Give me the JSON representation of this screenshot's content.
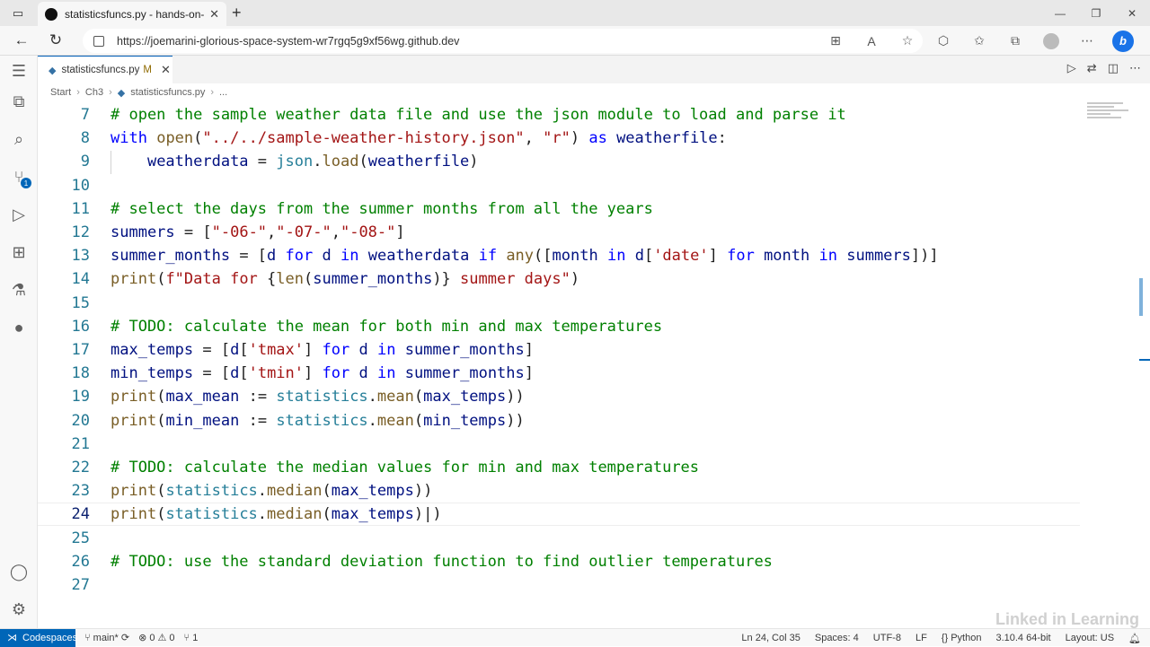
{
  "browser": {
    "tab_title": "statisticsfuncs.py - hands-on-adv",
    "url": "https://joemarini-glorious-space-system-wr7rgq5g9xf56wg.github.dev"
  },
  "editor": {
    "tab_label": "statisticsfuncs.py",
    "tab_modified": "M",
    "breadcrumb": [
      "Start",
      "Ch3",
      "statisticsfuncs.py",
      "..."
    ]
  },
  "code_lines": [
    {
      "n": "7",
      "html": "<span class='com'># open the sample weather data file and use the json module to load and parse it</span>"
    },
    {
      "n": "8",
      "html": "<span class='ctl'>with</span> <span class='fn'>open</span><span class='plain'>(</span><span class='str'>\"../../sample-weather-history.json\"</span><span class='plain'>, </span><span class='str'>\"r\"</span><span class='plain'>) </span><span class='ctl'>as</span> <span class='var'>weatherfile</span><span class='plain'>:</span>"
    },
    {
      "n": "9",
      "html": "    <span class='var'>weatherdata</span> <span class='plain'>=</span> <span class='mod'>json</span><span class='plain'>.</span><span class='fn'>load</span><span class='plain'>(</span><span class='var'>weatherfile</span><span class='plain'>)</span>"
    },
    {
      "n": "10",
      "html": ""
    },
    {
      "n": "11",
      "html": "<span class='com'># select the days from the summer months from all the years</span>"
    },
    {
      "n": "12",
      "html": "<span class='var'>summers</span> <span class='plain'>= [</span><span class='str'>\"-06-\"</span><span class='plain'>,</span><span class='str'>\"-07-\"</span><span class='plain'>,</span><span class='str'>\"-08-\"</span><span class='plain'>]</span>"
    },
    {
      "n": "13",
      "html": "<span class='var'>summer_months</span> <span class='plain'>= [</span><span class='var'>d</span> <span class='ctl'>for</span> <span class='var'>d</span> <span class='ctl'>in</span> <span class='var'>weatherdata</span> <span class='ctl'>if</span> <span class='fn'>any</span><span class='plain'>([</span><span class='var'>month</span> <span class='ctl'>in</span> <span class='var'>d</span><span class='plain'>[</span><span class='str'>'date'</span><span class='plain'>] </span><span class='ctl'>for</span> <span class='var'>month</span> <span class='ctl'>in</span> <span class='var'>summers</span><span class='plain'>])]</span>"
    },
    {
      "n": "14",
      "html": "<span class='fn'>print</span><span class='plain'>(</span><span class='str'>f\"Data for </span><span class='plain'>{</span><span class='fn'>len</span><span class='plain'>(</span><span class='var'>summer_months</span><span class='plain'>)}</span><span class='str'> summer days\"</span><span class='plain'>)</span>"
    },
    {
      "n": "15",
      "html": ""
    },
    {
      "n": "16",
      "html": "<span class='com'># TODO: calculate the mean for both min and max temperatures</span>"
    },
    {
      "n": "17",
      "html": "<span class='var'>max_temps</span> <span class='plain'>= [</span><span class='var'>d</span><span class='plain'>[</span><span class='str'>'tmax'</span><span class='plain'>] </span><span class='ctl'>for</span> <span class='var'>d</span> <span class='ctl'>in</span> <span class='var'>summer_months</span><span class='plain'>]</span>"
    },
    {
      "n": "18",
      "html": "<span class='var'>min_temps</span> <span class='plain'>= [</span><span class='var'>d</span><span class='plain'>[</span><span class='str'>'tmin'</span><span class='plain'>] </span><span class='ctl'>for</span> <span class='var'>d</span> <span class='ctl'>in</span> <span class='var'>summer_months</span><span class='plain'>]</span>"
    },
    {
      "n": "19",
      "html": "<span class='fn'>print</span><span class='plain'>(</span><span class='var'>max_mean</span> <span class='plain'>:=</span> <span class='mod'>statistics</span><span class='plain'>.</span><span class='fn'>mean</span><span class='plain'>(</span><span class='var'>max_temps</span><span class='plain'>))</span>"
    },
    {
      "n": "20",
      "html": "<span class='fn'>print</span><span class='plain'>(</span><span class='var'>min_mean</span> <span class='plain'>:=</span> <span class='mod'>statistics</span><span class='plain'>.</span><span class='fn'>mean</span><span class='plain'>(</span><span class='var'>min_temps</span><span class='plain'>))</span>"
    },
    {
      "n": "21",
      "html": ""
    },
    {
      "n": "22",
      "html": "<span class='com'># TODO: calculate the median values for min and max temperatures</span>"
    },
    {
      "n": "23",
      "html": "<span class='fn'>print</span><span class='plain'>(</span><span class='mod'>statistics</span><span class='plain'>.</span><span class='fn'>median</span><span class='plain'>(</span><span class='var'>max_temps</span><span class='plain'>))</span>"
    },
    {
      "n": "24",
      "html": "<span class='fn'>print</span><span class='plain'>(</span><span class='mod'>statistics</span><span class='plain'>.</span><span class='fn'>median</span><span class='plain'>(</span><span class='var'>max_temps</span><span class='plain'>)|)</span>"
    },
    {
      "n": "25",
      "html": ""
    },
    {
      "n": "26",
      "html": "<span class='com'># TODO: use the standard deviation function to find outlier temperatures</span>"
    },
    {
      "n": "27",
      "html": ""
    }
  ],
  "current_line": "24",
  "status": {
    "codespaces": "Codespaces",
    "branch": "main*",
    "problems": "⊗ 0 ⚠ 0",
    "ports": "1",
    "position": "Ln 24, Col 35",
    "spaces": "Spaces: 4",
    "encoding": "UTF-8",
    "eol": "LF",
    "language": "Python",
    "interpreter": "3.10.4 64-bit",
    "layout": "Layout: US"
  },
  "watermark": "Linked in Learning"
}
